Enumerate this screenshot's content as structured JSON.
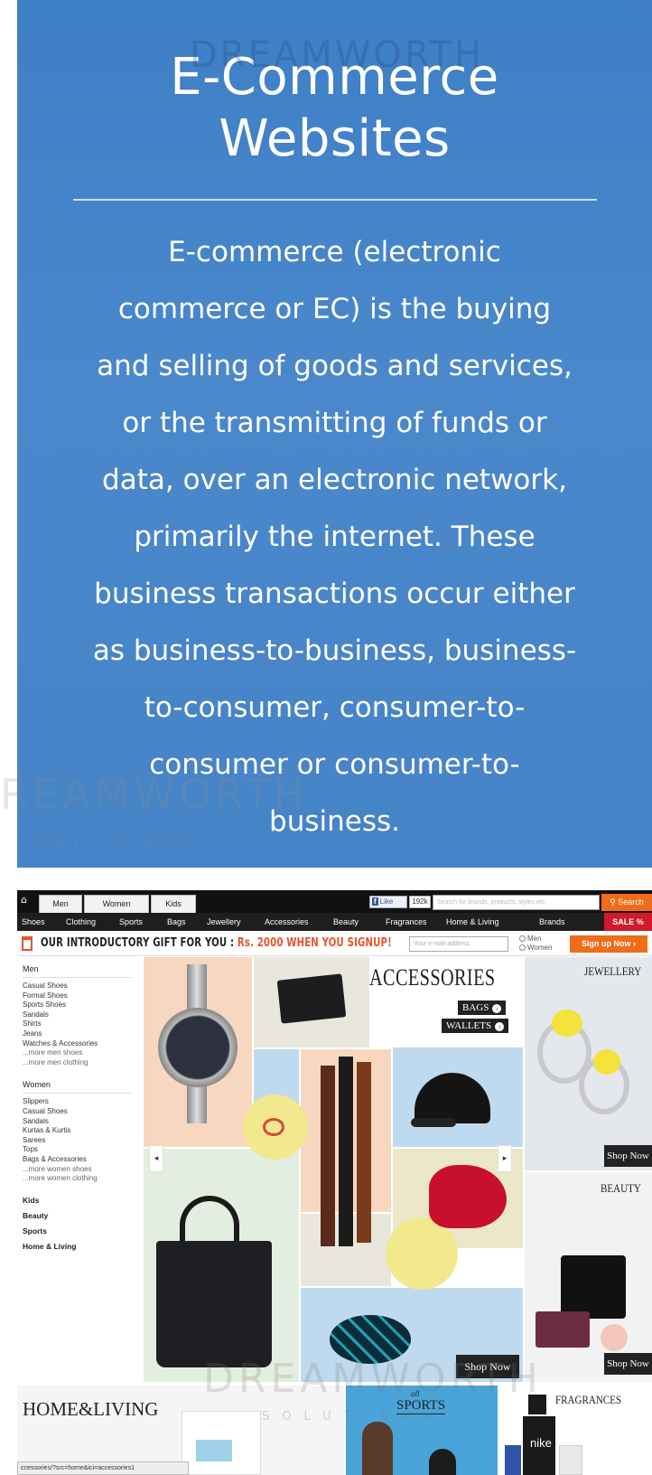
{
  "hero": {
    "title_line1": "E-Commerce",
    "title_line2": "Websites",
    "lines": [
      "E-commerce (electronic",
      "commerce or EC) is the buying",
      "and selling of goods and services,",
      "or the transmitting of funds or",
      "data, over an electronic network,",
      "primarily the internet. These",
      "business transactions occur either",
      "as business-to-business, business-",
      "to-consumer, consumer-to-",
      "consumer or consumer-to-",
      "business."
    ]
  },
  "watermark": {
    "word": "DREAMWORTH",
    "partial_word": "REAMWORTH",
    "sub": "SOLUTIONS"
  },
  "shop": {
    "gender_tabs": [
      "Men",
      "Women",
      "Kids"
    ],
    "fb_like": "Like",
    "fb_count": "192k",
    "search_placeholder": "Search for brands, products, styles etc.",
    "search_button": "Search",
    "categories": [
      "Shoes",
      "Clothing",
      "Sports",
      "Bags",
      "Jewellery",
      "Accessories",
      "Beauty",
      "Fragrances",
      "Home & Living",
      "Brands"
    ],
    "sale": "SALE %",
    "promo_prefix": "OUR INTRODUCTORY GIFT FOR YOU : ",
    "promo_highlight": "Rs. 2000 WHEN YOU SIGNUP!",
    "email_placeholder": "Your e-mail address",
    "radio_men": "Men",
    "radio_women": "Women",
    "signup_button": "Sign up Now ›",
    "sidebar": {
      "men_head": "Men",
      "men_items": [
        "Casual Shoes",
        "Formal Shoes",
        "Sports Shoes",
        "Sandals",
        "Shirts",
        "Jeans",
        "Watches & Accessories"
      ],
      "men_more": [
        "...more men shoes",
        "...more men clothing"
      ],
      "women_head": "Women",
      "women_items": [
        "Slippers",
        "Casual Shoes",
        "Sandals",
        "Kurtas & Kurtis",
        "Sarees",
        "Tops",
        "Bags & Accessories"
      ],
      "women_more": [
        "...more women shoes",
        "...more women clothing"
      ],
      "bottom_cats": [
        "Kids",
        "Beauty",
        "Sports",
        "Home & Living"
      ]
    },
    "collage": {
      "title": "ACCESSORIES",
      "pills": [
        "BAGS",
        "WALLETS"
      ],
      "shop_now": "Shop Now"
    },
    "right_col": {
      "jewellery": "JEWELLERY",
      "beauty": "BEAUTY",
      "shop_now": "Shop Now"
    },
    "bottom": {
      "home_living": "HOME&LIVING",
      "sports_all": "all",
      "sports": "SPORTS",
      "fragrances": "FRAGRANCES",
      "brand": "nike",
      "url": "ccessories/?src=home&ici=accessories1"
    }
  }
}
